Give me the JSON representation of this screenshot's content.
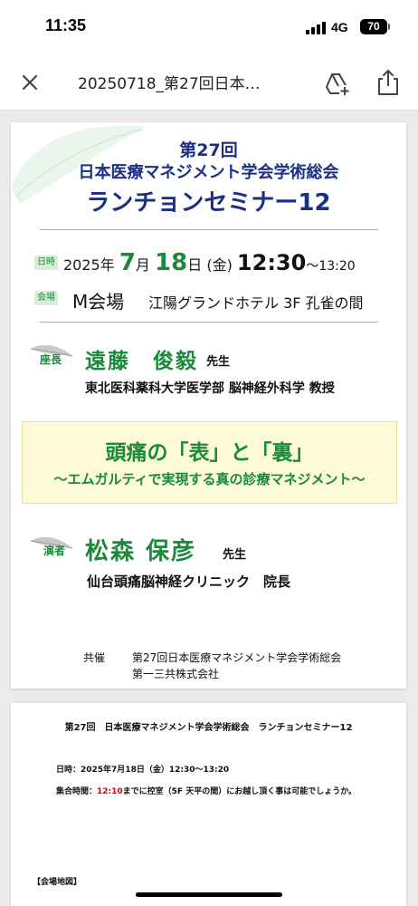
{
  "status_bar": {
    "time": "11:35",
    "network": "4G",
    "battery": "70"
  },
  "toolbar": {
    "title": "20250718_第27回日本…"
  },
  "poster": {
    "heading_line1": "第27回",
    "heading_line2": "日本医療マネジメント学会学術総会",
    "heading_line3": "ランチョンセミナー12",
    "date_tag": "日時",
    "date_year": "2025年",
    "date_month_num": "7",
    "date_month_unit": "月",
    "date_day_num": "18",
    "date_day_unit": "日",
    "date_weekday": "(金)",
    "date_start": "12:30",
    "date_end": "〜13:20",
    "venue_tag": "会場",
    "venue_room": "M会場",
    "venue_detail": "江陽グランドホテル 3F 孔雀の間",
    "chair_role": "座長",
    "chair_name": "遠藤　俊毅",
    "chair_honorific": "先生",
    "chair_affiliation": "東北医科薬科大学医学部 脳神経外科学 教授",
    "lecture_title": "頭痛の「表」と「裏」",
    "lecture_subtitle": "〜エムガルティで実現する真の診療マネジメント〜",
    "speaker_role": "演者",
    "speaker_name": "松森 保彦",
    "speaker_honorific": "先生",
    "speaker_affiliation": "仙台頭痛脳神経クリニック　院長",
    "cohost_label": "共催",
    "cohost_1": "第27回日本医療マネジメント学会学術総会",
    "cohost_2": "第一三共株式会社"
  },
  "page2": {
    "title": "第27回　日本医療マネジメント学会学術総会　ランチョンセミナー12",
    "date_line": "日時：2025年7月18日（金）12:30〜13:20",
    "meet_prefix": "集合時間：",
    "meet_time": "12:10",
    "meet_suffix": "までに控室（5F 天平の間）にお越し頂く事は可能でしょうか。",
    "map_label": "【会場地図】"
  },
  "colors": {
    "brand_navy": "#1a2f86",
    "accent_green": "#1a8a3a",
    "highlight_red": "#d0021b",
    "lecture_bg": "#fcfbd6"
  },
  "icons": [
    "close-icon",
    "drive-add-icon",
    "share-icon",
    "feather-icon",
    "signal-icon",
    "battery-icon"
  ]
}
